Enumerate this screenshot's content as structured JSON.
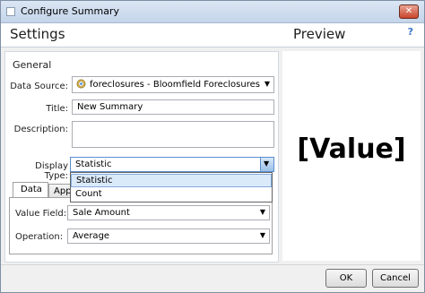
{
  "window": {
    "title": "Configure Summary",
    "close_glyph": "✕"
  },
  "header": {
    "settings": "Settings",
    "preview": "Preview",
    "help_glyph": "?"
  },
  "general": {
    "section": "General",
    "data_source_label": "Data Source:",
    "data_source_value": "foreclosures - Bloomfield Foreclosures",
    "title_label": "Title:",
    "title_value": "New Summary",
    "description_label": "Description:",
    "display_type_label": "Display Type:",
    "display_type_value": "Statistic"
  },
  "dropdown": {
    "options": [
      "Statistic",
      "Count"
    ],
    "selected_index": 0
  },
  "tabs": [
    {
      "label": "Data"
    },
    {
      "label": "App"
    }
  ],
  "data_tab": {
    "value_field_label": "Value Field:",
    "value_field_value": "Sale Amount",
    "operation_label": "Operation:",
    "operation_value": "Average"
  },
  "preview": {
    "value": "[Value]"
  },
  "footer": {
    "ok": "OK",
    "cancel": "Cancel"
  },
  "colors": {
    "accent": "#3a78c9",
    "selection": "#dbeaf9",
    "close": "#c9452b"
  },
  "icons": {
    "data_source": "globe-layer-icon",
    "dropdown_arrow": "chevron-down-icon",
    "help": "help-icon",
    "close": "close-icon"
  }
}
